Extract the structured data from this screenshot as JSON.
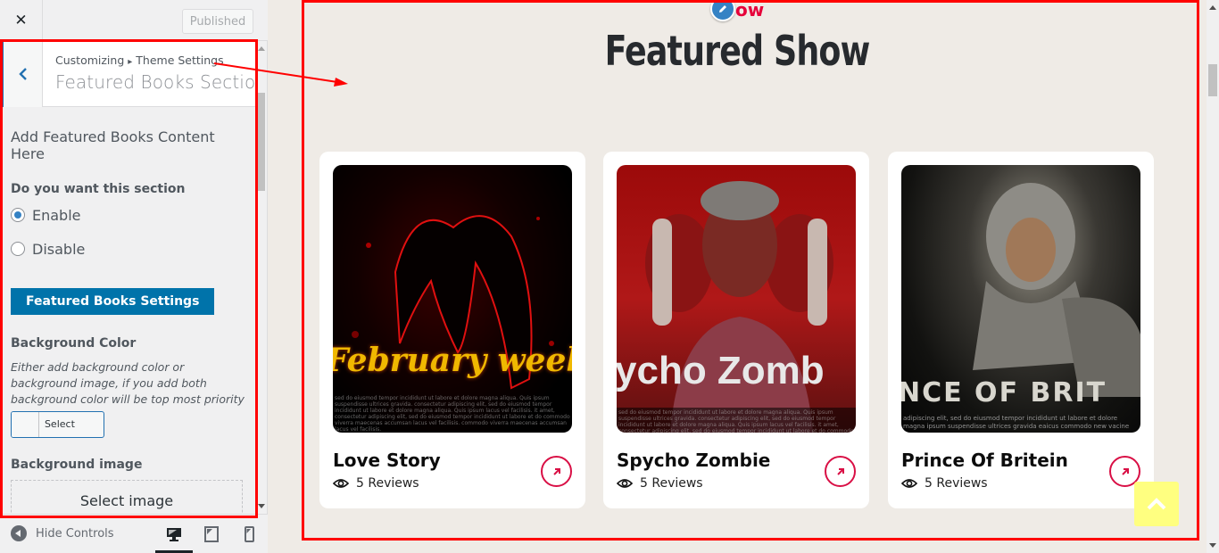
{
  "topbar": {
    "close_label": "✕",
    "publish_label": "Published"
  },
  "section": {
    "breadcrumb_root": "Customizing",
    "breadcrumb_sep": "▸",
    "breadcrumb_parent": "Theme Settings",
    "title": "Featured Books Section"
  },
  "controls": {
    "description": "Add Featured Books Content Here",
    "toggle_label": "Do you want this section",
    "radio_options": [
      {
        "label": "Enable",
        "checked": true
      },
      {
        "label": "Disable",
        "checked": false
      }
    ],
    "settings_button": "Featured Books Settings",
    "bg_color_label": "Background Color",
    "bg_color_desc": "Either add background color or background image, if you add both background color will be top most priority",
    "select_color": "Select Color",
    "bg_image_label": "Background image",
    "select_image": "Select image"
  },
  "footer": {
    "hide_controls": "Hide Controls",
    "devices": [
      "desktop",
      "tablet",
      "mobile"
    ],
    "active_device": "desktop"
  },
  "preview": {
    "eyebrow": "ow",
    "heading": "Featured Show",
    "accent_color": "#e6003a",
    "cards": [
      {
        "title": "Love Story",
        "reviews": "5 Reviews",
        "poster_text": "February week",
        "poster_fine_print": "sed do eiusmod tempor incididunt ut labore et dolore magna aliqua. Quis ipsum suspendisse ultrices gravida. consectetur adipiscing elit, sed do eiusmod tempor incididunt ut labore et dolore magna aliqua. Quis ipsum lacus vel facilisis. it amet, consectetur adipiscing elit, sed do eiusmod tempor incididunt ut labore et do commodo viverra maecenas accumsan lacus vel facilisis. commodo viverra maecenas accumsan lacus vel facilisis."
      },
      {
        "title": "Spycho Zombie",
        "reviews": "5 Reviews",
        "poster_text": "ycho Zomb",
        "poster_fine_print": "sed do eiusmod tempor incididunt ut labore et dolore magna aliqua. Quis ipsum suspendisse ultrices gravida. consectetur adipiscing elit, sed do eiusmod tempor incididunt ut labore et dolore magna aliqua. Quis ipsum lacus vel facilisis. it amet, consectetur adipiscing elit, sed do eiusmod tempor incididunt ut labore et do commodo viverra maecenas accumsan lacus vel facilisis."
      },
      {
        "title": "Prince Of Britein",
        "reviews": "5 Reviews",
        "poster_text": "NCE OF BRIT",
        "poster_fine_print": "adipiscing elit, sed do eiusmod tempor incididunt ut labore et dolore magna ipsum suspendisse ultrices gravida eaicus commodo new vacine ban"
      }
    ]
  }
}
